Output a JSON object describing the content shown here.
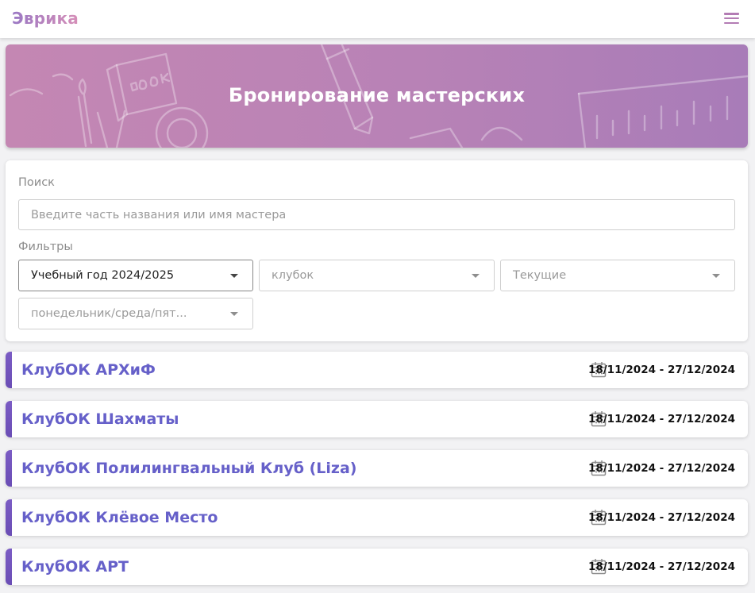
{
  "app": {
    "title": "Эврика"
  },
  "banner": {
    "title": "Бронирование мастерских"
  },
  "search": {
    "label": "Поиск",
    "placeholder": "Введите часть названия или имя мастера",
    "value": ""
  },
  "filters": {
    "label": "Фильтры",
    "school_year": "Учебный год 2024/2025",
    "club_type": "клубок",
    "period": "Текущие",
    "weekdays": "понедельник/среда/пят..."
  },
  "clubs": [
    {
      "name": "КлубОК АРХиФ",
      "dates": "18/11/2024 - 27/12/2024"
    },
    {
      "name": "КлубОК Шахматы",
      "dates": "18/11/2024 - 27/12/2024"
    },
    {
      "name": "КлубОК Полилингвальный Клуб (Liza)",
      "dates": "18/11/2024 - 27/12/2024"
    },
    {
      "name": "КлубОК Клёвое Место",
      "dates": "18/11/2024 - 27/12/2024"
    },
    {
      "name": "КлубОК АРТ",
      "dates": "18/11/2024 - 27/12/2024"
    }
  ],
  "icons": {
    "menu": "hamburger-menu-icon",
    "dropdown": "caret-down-icon",
    "date": "calendar-icon"
  },
  "colors": {
    "accent": "#6660c9",
    "accent_bar": "#7b5cc4",
    "banner_start": "#c487b3",
    "banner_end": "#a87cb8",
    "logo_start": "#9a78c4",
    "logo_end": "#d68fb8"
  }
}
